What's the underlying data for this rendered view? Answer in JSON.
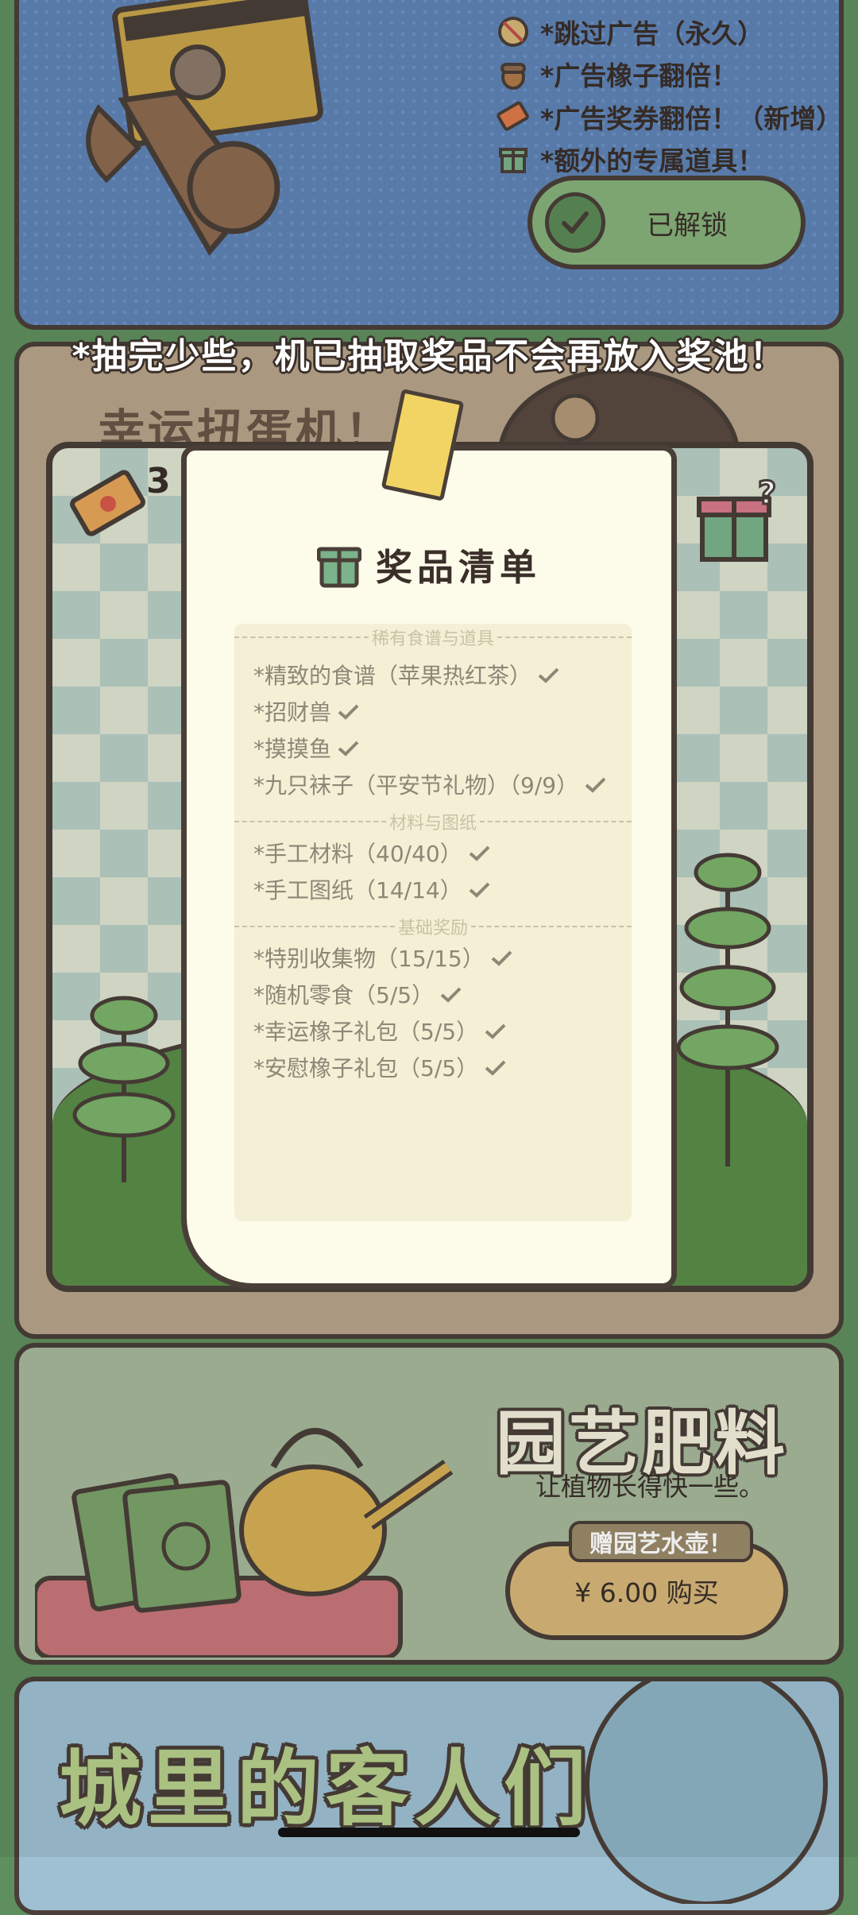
{
  "vip": {
    "perks": [
      {
        "icon": "no-ads-icon",
        "text": "*跳过广告（永久）"
      },
      {
        "icon": "acorn-icon",
        "text": "*广告橡子翻倍！"
      },
      {
        "icon": "ticket-icon",
        "text": "*广告奖券翻倍！（新增）"
      },
      {
        "icon": "gift-icon",
        "text": "*额外的专属道具！"
      }
    ],
    "unlock_label": "已解锁"
  },
  "gacha": {
    "note": "*抽完少些，机已抽取奖品不会再放入奖池！",
    "title": "幸运扭蛋机！",
    "ticket_count": "3"
  },
  "prize_list": {
    "title": "奖品清单",
    "sections": [
      {
        "label": "稀有食谱与道具",
        "items": [
          "*精致的食谱（苹果热红茶）",
          "*招财兽",
          "*摸摸鱼",
          "*九只袜子（平安节礼物）（9/9）"
        ]
      },
      {
        "label": "材料与图纸",
        "items": [
          "*手工材料（40/40）",
          "*手工图纸（14/14）"
        ]
      },
      {
        "label": "基础奖励",
        "items": [
          "*特别收集物（15/15）",
          "*随机零食（5/5）",
          "*幸运橡子礼包（5/5）",
          "*安慰橡子礼包（5/5）"
        ]
      }
    ]
  },
  "fertilizer": {
    "title": "园艺肥料",
    "desc": "让植物长得快一些。",
    "badge": "赠园艺水壶！",
    "buy_label": "¥ 6.00 购买"
  },
  "city": {
    "title": "城里的客人们"
  },
  "colors": {
    "outline": "#4a3f38",
    "paper": "#fdfbe9",
    "check": "#8f8676"
  }
}
